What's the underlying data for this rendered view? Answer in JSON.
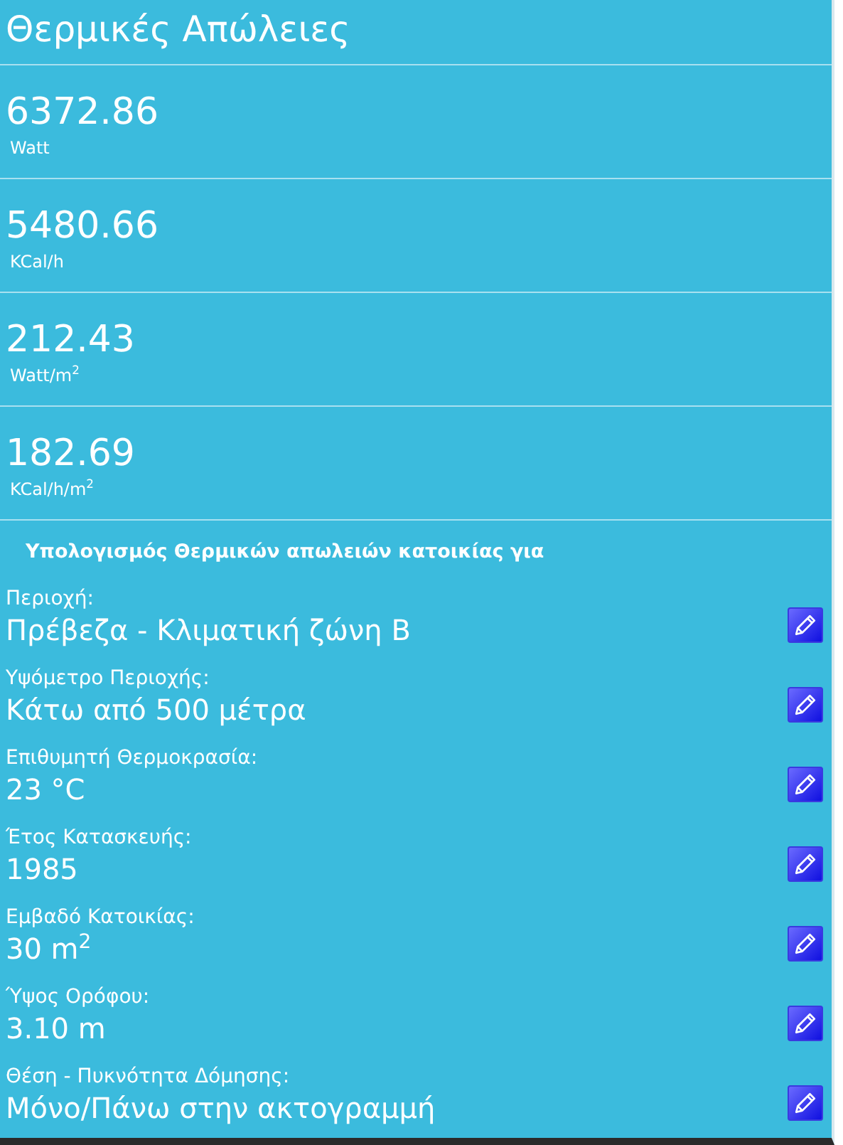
{
  "title": "Θερμικές Απώλειες",
  "metrics": [
    {
      "value": "6372.86",
      "unit": "Watt"
    },
    {
      "value": "5480.66",
      "unit": "KCal/h"
    },
    {
      "value": "212.43",
      "unit": "Watt/m$^{2}$"
    },
    {
      "value": "182.69",
      "unit": "KCal/h/m$^{2}$"
    }
  ],
  "section_heading": "Υπολογισμός Θερμικών απωλειών κατοικίας για",
  "fields": [
    {
      "label": "Περιοχή:",
      "value": "Πρέβεζα - Κλιματική ζώνη Β"
    },
    {
      "label": "Υψόμετρο Περιοχής:",
      "value": "Κάτω από 500 μέτρα"
    },
    {
      "label": "Επιθυμητή Θερμοκρασία:",
      "value": "23 °C"
    },
    {
      "label": "Έτος Κατασκευής:",
      "value": "1985"
    },
    {
      "label": "Εμβαδό Κατοικίας:",
      "value": "30 m$^{2}$"
    },
    {
      "label": "Ύψος Ορόφου:",
      "value": "3.10 m"
    },
    {
      "label": "Θέση - Πυκνότητα Δόμησης:",
      "value": "Μόνο/Πάνω στην ακτογραμμή"
    }
  ]
}
